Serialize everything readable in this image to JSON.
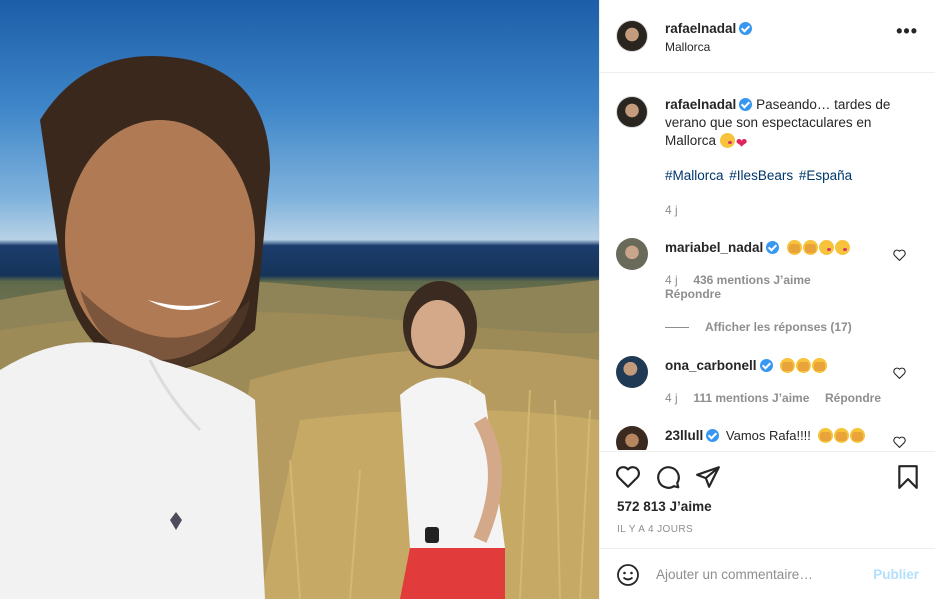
{
  "post": {
    "author": "rafaelnadal",
    "location": "Mallorca",
    "more_icon": "•••"
  },
  "caption": {
    "author": "rafaelnadal",
    "text": "Paseando… tardes de verano que son espectaculares en Mallorca",
    "hashtags": [
      "#Mallorca",
      "#IlesBears",
      "#España"
    ],
    "time": "4 j"
  },
  "comments": [
    {
      "author": "mariabel_nadal",
      "emojis": [
        "hands",
        "hands",
        "kiss",
        "kiss"
      ],
      "text": "",
      "time": "4 j",
      "likes": "436 mentions J’aime",
      "reply": "Répondre"
    },
    {
      "author": "ona_carbonell",
      "emojis": [
        "hands",
        "hands",
        "hands"
      ],
      "text": "",
      "time": "4 j",
      "likes": "111 mentions J’aime",
      "reply": "Répondre"
    },
    {
      "author": "23llull",
      "emojis": [
        "hands",
        "hands",
        "hands"
      ],
      "text": "Vamos Rafa!!!!",
      "time": "",
      "likes": "",
      "reply": ""
    }
  ],
  "view_replies": "Afficher les réponses (17)",
  "likes_total": "572 813 J’aime",
  "posted_ago": "IL Y A 4 JOURS",
  "add_comment": {
    "placeholder": "Ajouter un commentaire…",
    "publish": "Publier"
  },
  "icons": [
    "heart-icon",
    "comment-icon",
    "share-icon",
    "bookmark-icon",
    "smile-icon",
    "verified-icon",
    "more-icon"
  ],
  "colors": {
    "link": "#00376b",
    "verified": "#3897f0",
    "publish_disabled": "#b2dffc",
    "meta": "#8e8e8e"
  }
}
